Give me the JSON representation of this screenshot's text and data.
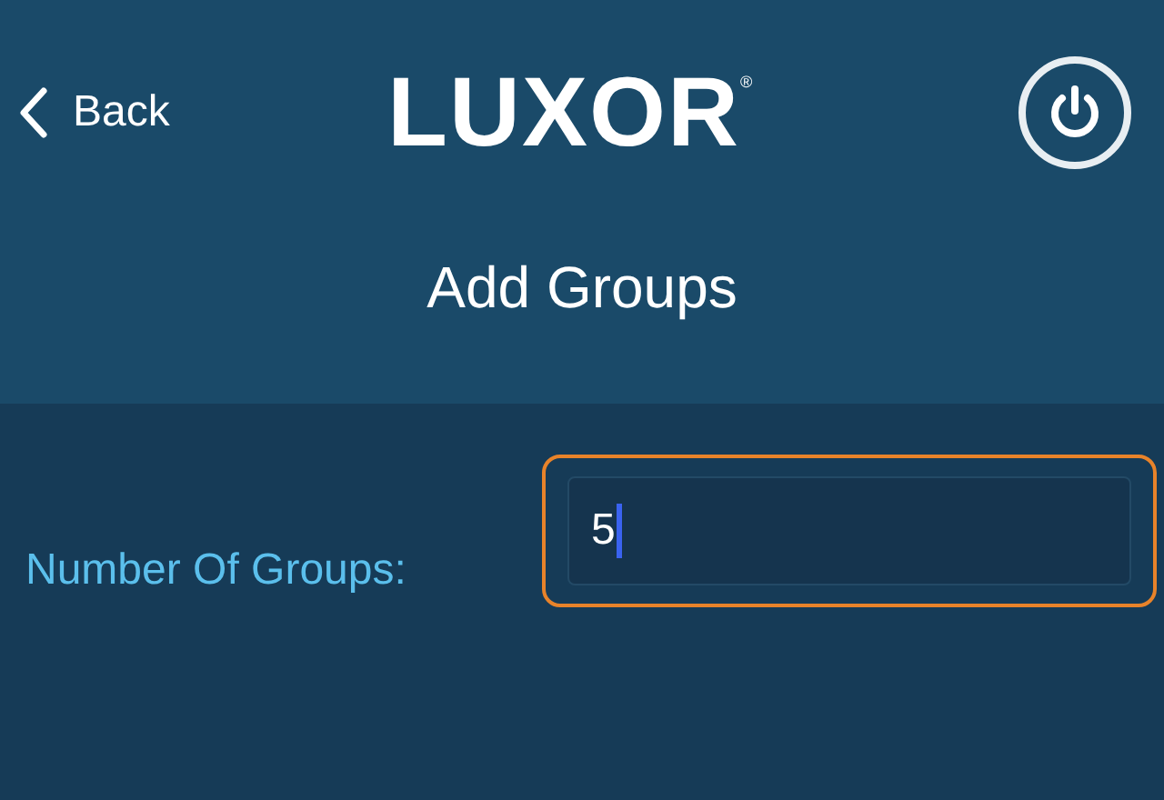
{
  "header": {
    "back_label": "Back",
    "logo": {
      "text": "LUXOR",
      "mark": "®"
    }
  },
  "title": "Add Groups",
  "form": {
    "label": "Number Of Groups:",
    "value": "5",
    "focused": true
  }
}
